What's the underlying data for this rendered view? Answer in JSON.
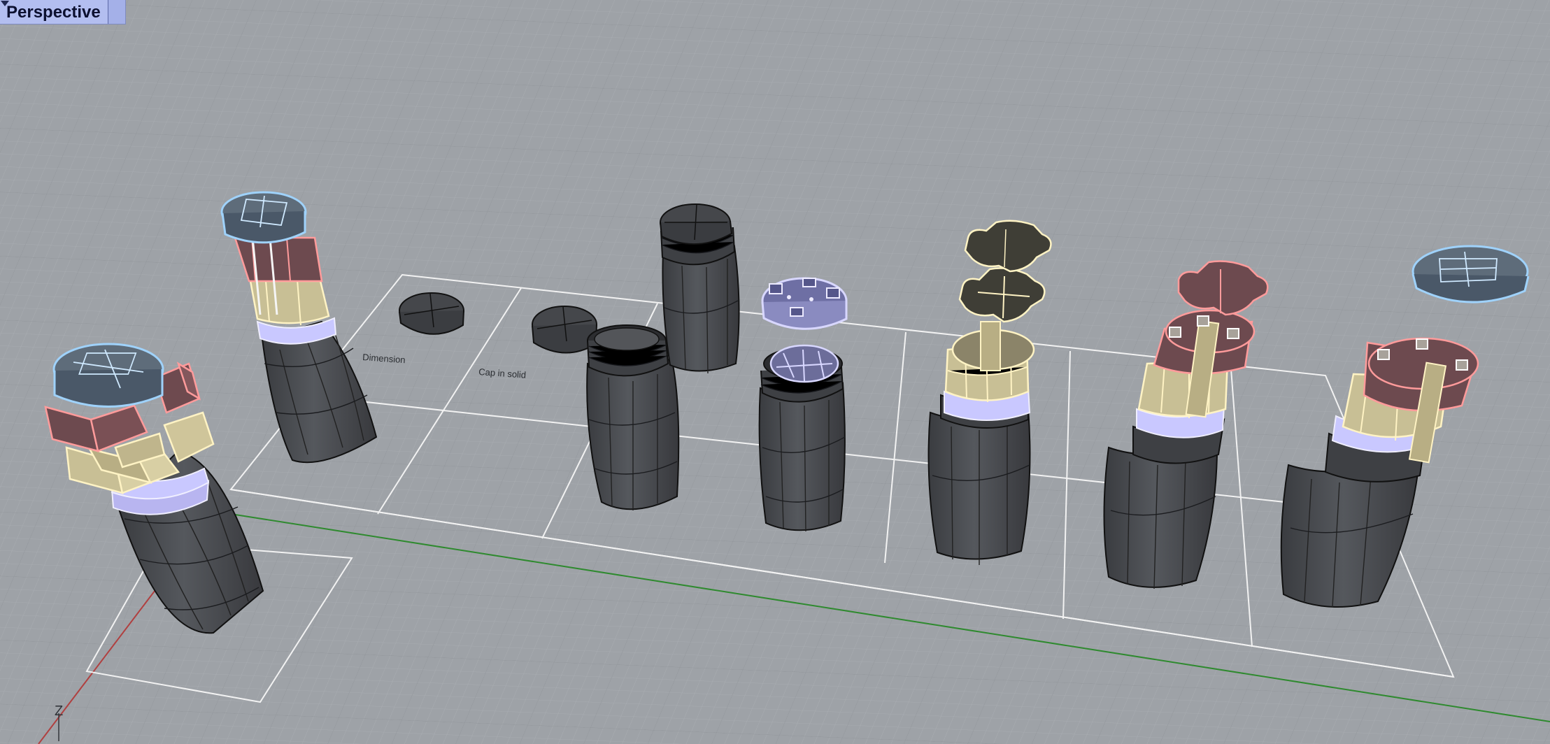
{
  "viewport": {
    "title": "Perspective",
    "dropdown_icon": "triangle-down-icon",
    "axis_label": "Z",
    "labels": {
      "dimension": "Dimension",
      "cap_in_solid": "Cap in solid"
    }
  },
  "colors": {
    "background": "#9ea2a7",
    "grid_minor": "#a7abb0",
    "grid_major": "#8e9297",
    "x_axis": "#b04040",
    "y_axis": "#2f8a2f",
    "tab_background": "#b3bef0",
    "selection_blue": "#8fc4f2",
    "selection_red": "#ff9b9b",
    "selection_yellow": "#fff0b0",
    "selection_lavender": "#c9c8ff",
    "bottle_dark": "#46484d"
  }
}
